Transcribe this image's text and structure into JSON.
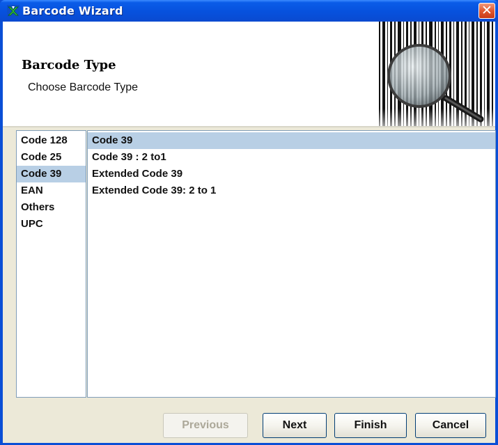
{
  "window": {
    "title": "Barcode Wizard"
  },
  "header": {
    "title": "Barcode Type",
    "subtitle": "Choose Barcode Type"
  },
  "categories": [
    {
      "label": "Code 128",
      "selected": false
    },
    {
      "label": "Code 25",
      "selected": false
    },
    {
      "label": "Code 39",
      "selected": true
    },
    {
      "label": "EAN",
      "selected": false
    },
    {
      "label": "Others",
      "selected": false
    },
    {
      "label": "UPC",
      "selected": false
    }
  ],
  "types": [
    {
      "label": "Code 39",
      "selected": true
    },
    {
      "label": "Code 39 : 2 to1",
      "selected": false
    },
    {
      "label": "Extended Code 39",
      "selected": false
    },
    {
      "label": "Extended Code 39: 2 to 1",
      "selected": false
    }
  ],
  "buttons": {
    "previous": "Previous",
    "next": "Next",
    "finish": "Finish",
    "cancel": "Cancel"
  },
  "colors": {
    "titlebar": "#0a4fd6",
    "selection": "#b8cfe5",
    "dialog_bg": "#ece9d8"
  }
}
